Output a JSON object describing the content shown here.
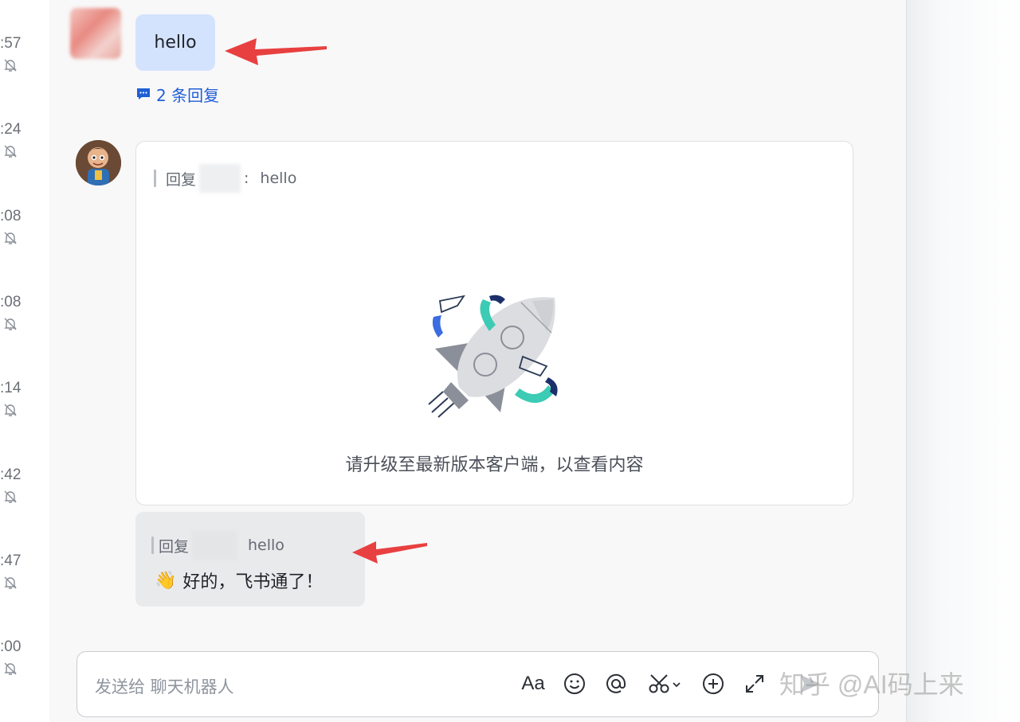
{
  "left_column": {
    "times": [
      ":57",
      ":24",
      ":08",
      ":08",
      ":14",
      ":42",
      ":47",
      ":00"
    ]
  },
  "messages": {
    "first": {
      "text": "hello",
      "replies_link": "2 条回复"
    },
    "card": {
      "quote_prefix": "回复",
      "quote_sep": ":",
      "quote_text": "hello",
      "upgrade_notice": "请升级至最新版本客户端，以查看内容"
    },
    "reply": {
      "quote_prefix": "回复",
      "quote_text": "hello",
      "emoji": "👋",
      "text": "好的，飞书通了！"
    }
  },
  "composer": {
    "placeholder": "发送给 聊天机器人",
    "tools": [
      "text-format-icon",
      "emoji-icon",
      "mention-icon",
      "screenshot-icon",
      "add-icon",
      "expand-icon",
      "send-icon"
    ],
    "format_label": "Aa"
  },
  "watermark": "知乎 @AI码上来",
  "colors": {
    "accent": "#1f5fd6",
    "own_bubble": "#d4e3fd",
    "reply_bubble": "#e9eaec",
    "arrow": "#e84040"
  }
}
